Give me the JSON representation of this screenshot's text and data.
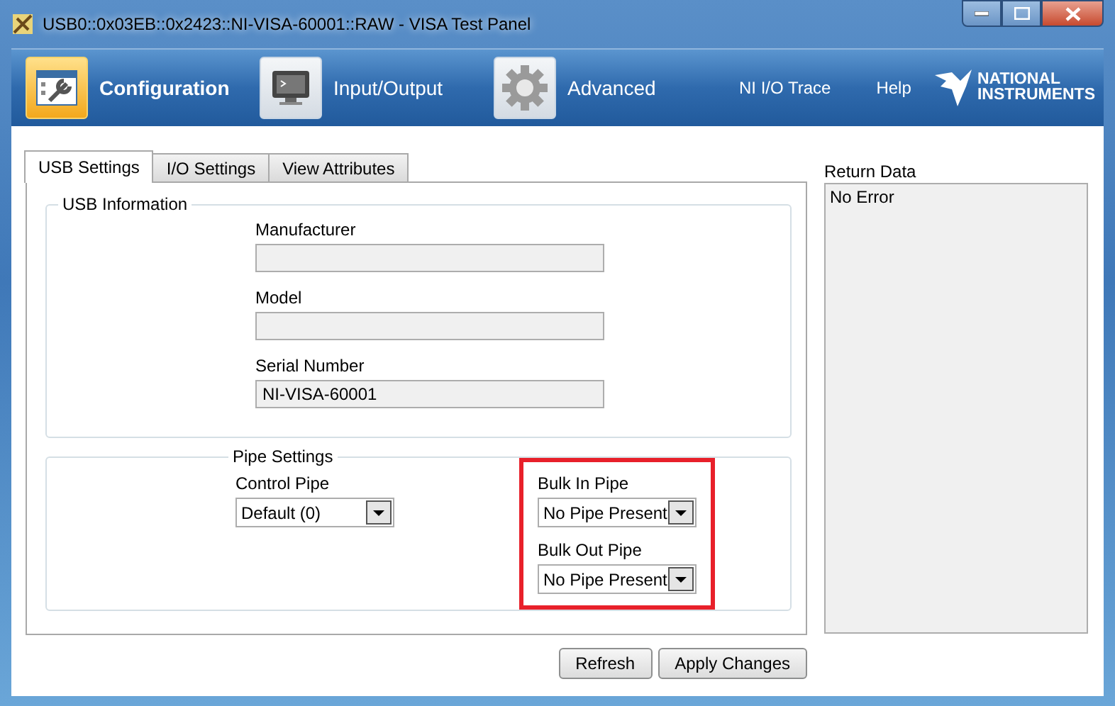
{
  "window": {
    "title": "USB0::0x03EB::0x2423::NI-VISA-60001::RAW - VISA Test Panel"
  },
  "toolbar": {
    "items": [
      {
        "label": "Configuration",
        "selected": true
      },
      {
        "label": "Input/Output",
        "selected": false
      },
      {
        "label": "Advanced",
        "selected": false
      }
    ],
    "links": [
      "NI I/O Trace",
      "Help"
    ],
    "logo": [
      "NATIONAL",
      "INSTRUMENTS"
    ]
  },
  "tabs": [
    {
      "label": "USB Settings",
      "selected": true
    },
    {
      "label": "I/O Settings",
      "selected": false
    },
    {
      "label": "View Attributes",
      "selected": false
    }
  ],
  "usb_information": {
    "title": "USB Information",
    "fields": [
      {
        "label": "Manufacturer"
      },
      {
        "label": "Model"
      },
      {
        "label": "Serial Number",
        "value": "NI-VISA-60001"
      }
    ]
  },
  "pipe_settings": {
    "title": "Pipe Settings",
    "pipes": [
      {
        "label": "Control Pipe",
        "value": "Default (0)",
        "highlighted": false
      },
      {
        "label": "Bulk In Pipe",
        "value": "No Pipe Present",
        "highlighted": true
      },
      {
        "label": "Bulk Out Pipe",
        "value": "No Pipe Present",
        "highlighted": true
      }
    ]
  },
  "return_data": {
    "label": "Return Data",
    "value": "No Error"
  },
  "buttons": [
    "Refresh",
    "Apply Changes"
  ]
}
